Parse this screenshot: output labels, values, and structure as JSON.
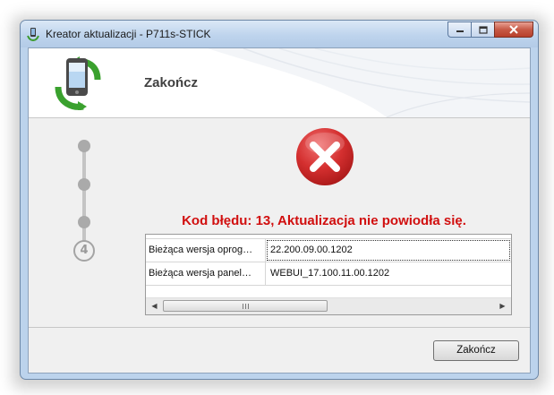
{
  "window": {
    "title": "Kreator aktualizacji - P711s-STICK",
    "app_icon": "phone-update-icon",
    "caption_buttons": [
      "minimize-icon",
      "maximize-icon",
      "close-icon"
    ]
  },
  "header": {
    "title": "Zakończ",
    "icon": "phone-sync-icon"
  },
  "steps": {
    "current_step": "4",
    "icons": [
      "step-dot",
      "step-dot",
      "step-dot",
      "step-current"
    ]
  },
  "status": {
    "icon": "error-x-icon",
    "message": "Kod błędu: 13, Aktualizacja nie powiodła się."
  },
  "info_table": {
    "rows": [
      {
        "name": "Bieżąca wersja oprog…",
        "value": "22.200.09.00.1202"
      },
      {
        "name": "Bieżąca wersja panel…",
        "value": "WEBUI_17.100.11.00.1202"
      }
    ]
  },
  "footer": {
    "finish_label": "Zakończ"
  },
  "colors": {
    "error_text": "#d10f0f",
    "title_bar": "#bed4ed",
    "error_icon": "#c8262a"
  }
}
